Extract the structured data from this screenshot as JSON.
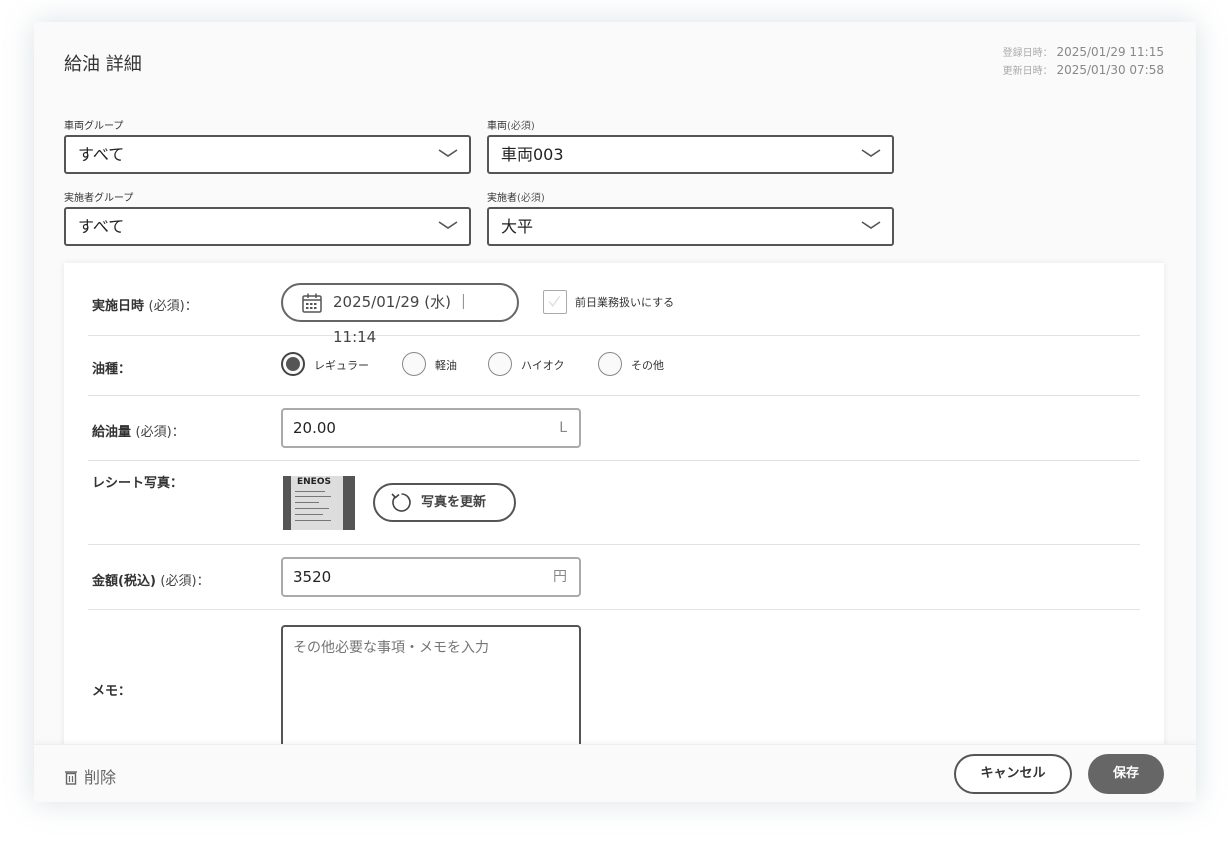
{
  "dialog": {
    "title": "給油 詳細",
    "registered_label": "登録日時：",
    "registered_value": "2025/01/29 11:15",
    "updated_label": "更新日時：",
    "updated_value": "2025/01/30 07:58"
  },
  "filters": {
    "vehicle_group_label": "車両グループ",
    "vehicle_group_value": "すべて",
    "vehicle_label": "車両",
    "vehicle_required": "(必須)",
    "vehicle_value": "車両003",
    "operator_group_label": "実施者グループ",
    "operator_group_value": "すべて",
    "operator_label": "実施者",
    "operator_required": "(必須)",
    "operator_value": "大平"
  },
  "form": {
    "datetime_label": "実施日時",
    "datetime_required": "(必須)：",
    "datetime_value": "2025/01/29 (水) ｜ 11:14",
    "prev_day_label": "前日業務扱いにする",
    "prev_day_checked": false,
    "fuel_type_label": "油種：",
    "fuel_types": [
      "レギュラー",
      "軽油",
      "ハイオク",
      "その他"
    ],
    "fuel_type_selected": "レギュラー",
    "amount_label": "給油量",
    "amount_required": "(必須)：",
    "amount_value": "20.00",
    "amount_unit": "L",
    "receipt_label": "レシート写真：",
    "receipt_brand": "ENEOS",
    "update_photo_label": "写真を更新",
    "price_label": "金額(税込)",
    "price_required": "(必須)：",
    "price_value": "3520",
    "price_unit": "円",
    "memo_label": "メモ：",
    "memo_placeholder": "その他必要な事項・メモを入力"
  },
  "footer": {
    "delete_label": "削除",
    "cancel_label": "キャンセル",
    "save_label": "保存"
  },
  "icons": {
    "chevron": "chevron-down-icon",
    "calendar": "calendar-icon",
    "refresh": "refresh-icon",
    "trash": "trash-icon"
  }
}
